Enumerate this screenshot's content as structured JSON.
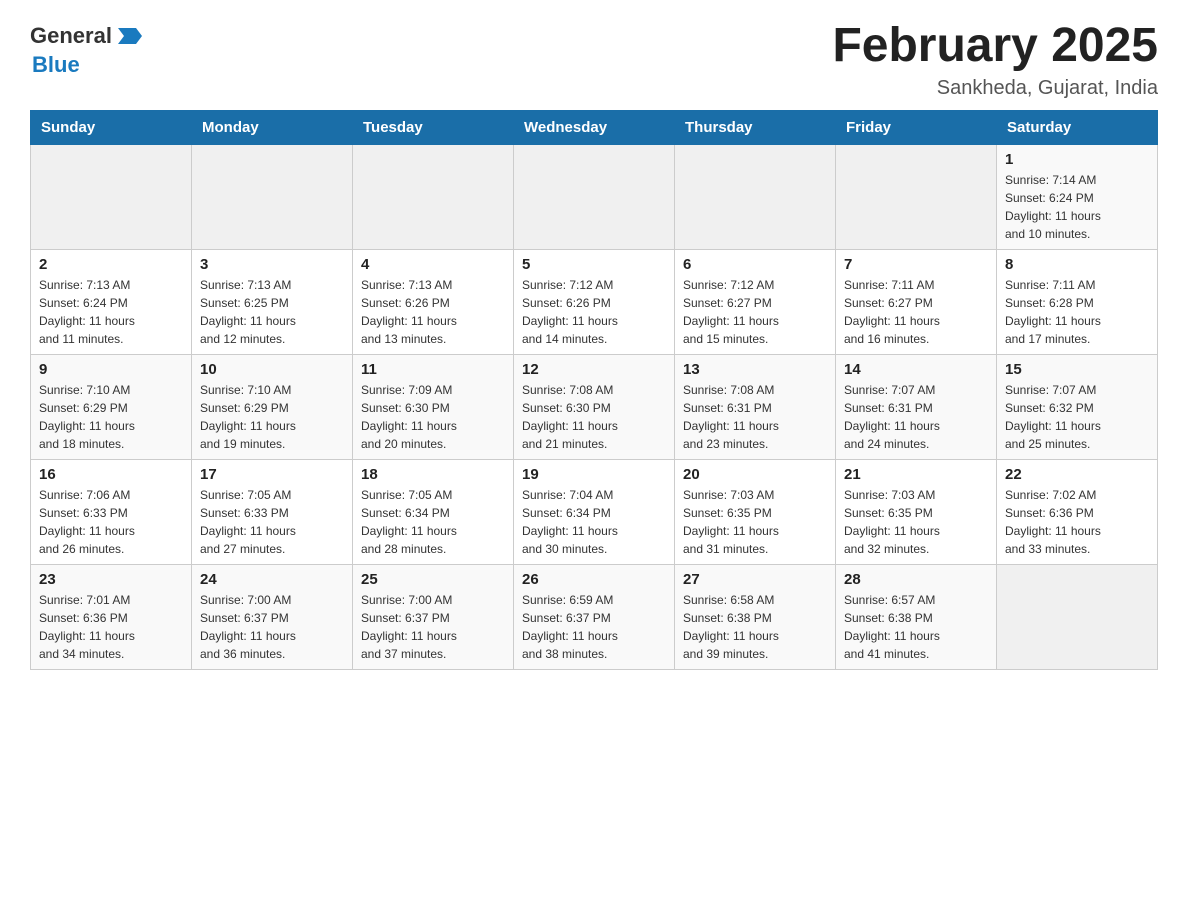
{
  "header": {
    "logo_general": "General",
    "logo_blue": "Blue",
    "title": "February 2025",
    "subtitle": "Sankheda, Gujarat, India"
  },
  "days_of_week": [
    "Sunday",
    "Monday",
    "Tuesday",
    "Wednesday",
    "Thursday",
    "Friday",
    "Saturday"
  ],
  "weeks": [
    [
      {
        "day": "",
        "info": ""
      },
      {
        "day": "",
        "info": ""
      },
      {
        "day": "",
        "info": ""
      },
      {
        "day": "",
        "info": ""
      },
      {
        "day": "",
        "info": ""
      },
      {
        "day": "",
        "info": ""
      },
      {
        "day": "1",
        "info": "Sunrise: 7:14 AM\nSunset: 6:24 PM\nDaylight: 11 hours\nand 10 minutes."
      }
    ],
    [
      {
        "day": "2",
        "info": "Sunrise: 7:13 AM\nSunset: 6:24 PM\nDaylight: 11 hours\nand 11 minutes."
      },
      {
        "day": "3",
        "info": "Sunrise: 7:13 AM\nSunset: 6:25 PM\nDaylight: 11 hours\nand 12 minutes."
      },
      {
        "day": "4",
        "info": "Sunrise: 7:13 AM\nSunset: 6:26 PM\nDaylight: 11 hours\nand 13 minutes."
      },
      {
        "day": "5",
        "info": "Sunrise: 7:12 AM\nSunset: 6:26 PM\nDaylight: 11 hours\nand 14 minutes."
      },
      {
        "day": "6",
        "info": "Sunrise: 7:12 AM\nSunset: 6:27 PM\nDaylight: 11 hours\nand 15 minutes."
      },
      {
        "day": "7",
        "info": "Sunrise: 7:11 AM\nSunset: 6:27 PM\nDaylight: 11 hours\nand 16 minutes."
      },
      {
        "day": "8",
        "info": "Sunrise: 7:11 AM\nSunset: 6:28 PM\nDaylight: 11 hours\nand 17 minutes."
      }
    ],
    [
      {
        "day": "9",
        "info": "Sunrise: 7:10 AM\nSunset: 6:29 PM\nDaylight: 11 hours\nand 18 minutes."
      },
      {
        "day": "10",
        "info": "Sunrise: 7:10 AM\nSunset: 6:29 PM\nDaylight: 11 hours\nand 19 minutes."
      },
      {
        "day": "11",
        "info": "Sunrise: 7:09 AM\nSunset: 6:30 PM\nDaylight: 11 hours\nand 20 minutes."
      },
      {
        "day": "12",
        "info": "Sunrise: 7:08 AM\nSunset: 6:30 PM\nDaylight: 11 hours\nand 21 minutes."
      },
      {
        "day": "13",
        "info": "Sunrise: 7:08 AM\nSunset: 6:31 PM\nDaylight: 11 hours\nand 23 minutes."
      },
      {
        "day": "14",
        "info": "Sunrise: 7:07 AM\nSunset: 6:31 PM\nDaylight: 11 hours\nand 24 minutes."
      },
      {
        "day": "15",
        "info": "Sunrise: 7:07 AM\nSunset: 6:32 PM\nDaylight: 11 hours\nand 25 minutes."
      }
    ],
    [
      {
        "day": "16",
        "info": "Sunrise: 7:06 AM\nSunset: 6:33 PM\nDaylight: 11 hours\nand 26 minutes."
      },
      {
        "day": "17",
        "info": "Sunrise: 7:05 AM\nSunset: 6:33 PM\nDaylight: 11 hours\nand 27 minutes."
      },
      {
        "day": "18",
        "info": "Sunrise: 7:05 AM\nSunset: 6:34 PM\nDaylight: 11 hours\nand 28 minutes."
      },
      {
        "day": "19",
        "info": "Sunrise: 7:04 AM\nSunset: 6:34 PM\nDaylight: 11 hours\nand 30 minutes."
      },
      {
        "day": "20",
        "info": "Sunrise: 7:03 AM\nSunset: 6:35 PM\nDaylight: 11 hours\nand 31 minutes."
      },
      {
        "day": "21",
        "info": "Sunrise: 7:03 AM\nSunset: 6:35 PM\nDaylight: 11 hours\nand 32 minutes."
      },
      {
        "day": "22",
        "info": "Sunrise: 7:02 AM\nSunset: 6:36 PM\nDaylight: 11 hours\nand 33 minutes."
      }
    ],
    [
      {
        "day": "23",
        "info": "Sunrise: 7:01 AM\nSunset: 6:36 PM\nDaylight: 11 hours\nand 34 minutes."
      },
      {
        "day": "24",
        "info": "Sunrise: 7:00 AM\nSunset: 6:37 PM\nDaylight: 11 hours\nand 36 minutes."
      },
      {
        "day": "25",
        "info": "Sunrise: 7:00 AM\nSunset: 6:37 PM\nDaylight: 11 hours\nand 37 minutes."
      },
      {
        "day": "26",
        "info": "Sunrise: 6:59 AM\nSunset: 6:37 PM\nDaylight: 11 hours\nand 38 minutes."
      },
      {
        "day": "27",
        "info": "Sunrise: 6:58 AM\nSunset: 6:38 PM\nDaylight: 11 hours\nand 39 minutes."
      },
      {
        "day": "28",
        "info": "Sunrise: 6:57 AM\nSunset: 6:38 PM\nDaylight: 11 hours\nand 41 minutes."
      },
      {
        "day": "",
        "info": ""
      }
    ]
  ]
}
